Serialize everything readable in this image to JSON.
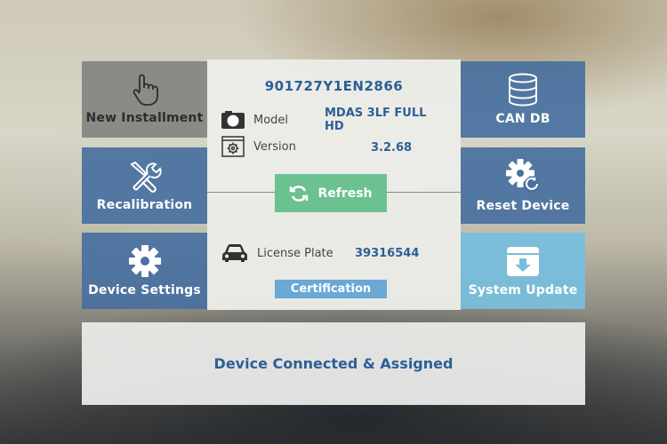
{
  "tiles": {
    "new_installment": {
      "label": "New Installment",
      "icon": "hand-pointer-icon"
    },
    "recalibration": {
      "label": "Recalibration",
      "icon": "tools-icon"
    },
    "device_settings": {
      "label": "Device Settings",
      "icon": "gear-icon"
    },
    "can_db": {
      "label": "CAN DB",
      "icon": "database-icon"
    },
    "reset_device": {
      "label": "Reset Device",
      "icon": "gear-reset-icon"
    },
    "system_update": {
      "label": "System Update",
      "icon": "download-box-icon"
    }
  },
  "info": {
    "serial": "901727Y1EN2866",
    "model_label": "Model",
    "model_value": "MDAS 3LF FULL HD",
    "version_label": "Version",
    "version_value": "3.2.68",
    "refresh_label": "Refresh",
    "plate_label": "License Plate",
    "plate_value": "39316544",
    "cert_label": "Certification"
  },
  "status": {
    "text": "Device Connected & Assigned"
  },
  "colors": {
    "tile_blue": "#4870a0",
    "tile_gray": "#82827f",
    "tile_light_blue": "#78bedc",
    "accent_text": "#2b5f97",
    "refresh_green": "#6cc191",
    "cert_blue": "#6aa8d6"
  }
}
